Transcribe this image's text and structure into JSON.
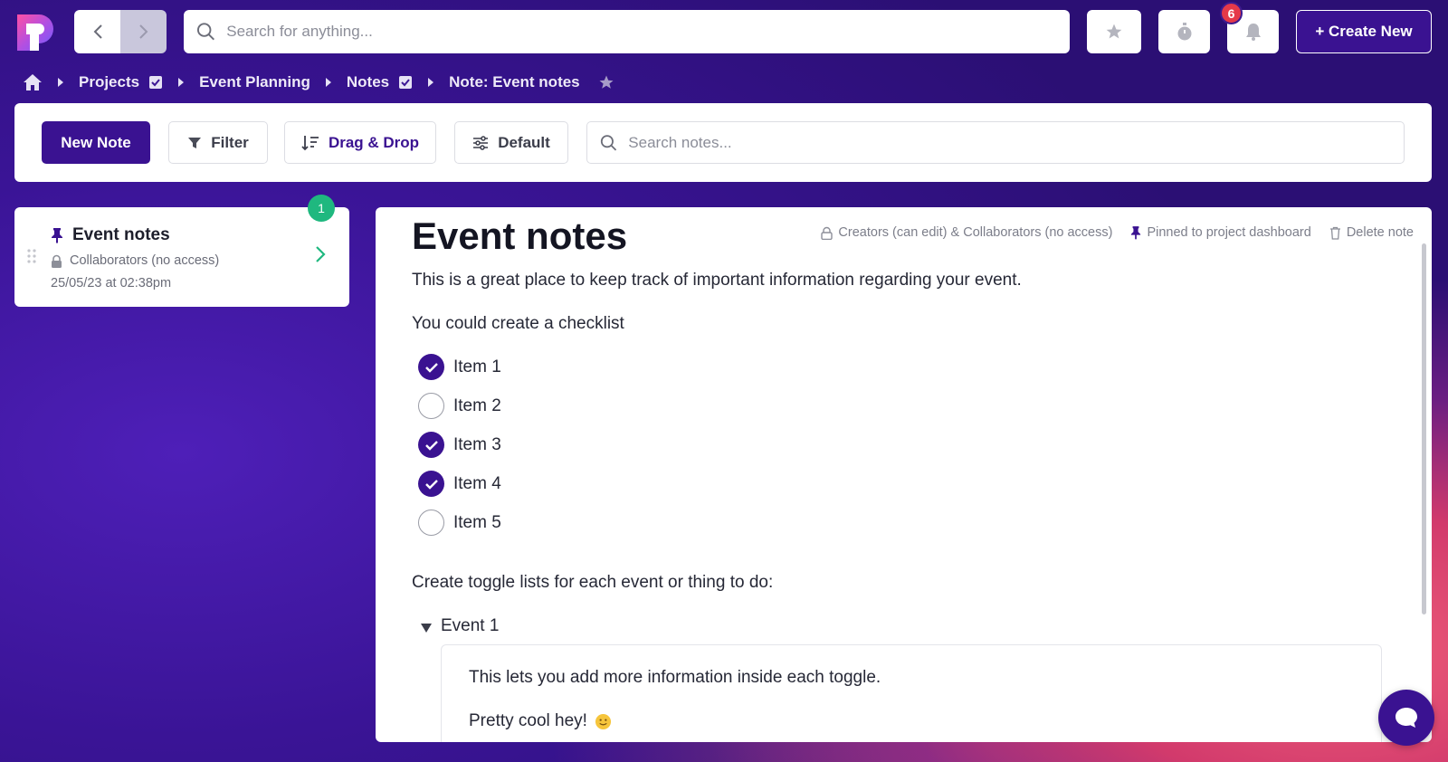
{
  "topbar": {
    "search_placeholder": "Search for anything...",
    "notification_count": "6",
    "create_label": "+ Create New"
  },
  "breadcrumb": {
    "items": [
      "Projects",
      "Event Planning",
      "Notes",
      "Note: Event notes"
    ]
  },
  "toolbar": {
    "new_note_label": "New Note",
    "filter_label": "Filter",
    "drag_label": "Drag & Drop",
    "default_label": "Default",
    "search_placeholder": "Search notes..."
  },
  "note_list": {
    "count": "1",
    "items": [
      {
        "title": "Event notes",
        "access": "Collaborators (no access)",
        "date": "25/05/23 at 02:38pm"
      }
    ]
  },
  "note": {
    "title": "Event notes",
    "meta": {
      "permissions": "Creators (can edit) & Collaborators (no access)",
      "pinned": "Pinned to project dashboard",
      "delete": "Delete note"
    },
    "intro": "This is a great place to keep track of important information regarding your event.",
    "checklist_heading": "You could create a checklist",
    "checklist": [
      {
        "label": "Item 1",
        "checked": true
      },
      {
        "label": "Item 2",
        "checked": false
      },
      {
        "label": "Item 3",
        "checked": true
      },
      {
        "label": "Item 4",
        "checked": true
      },
      {
        "label": "Item 5",
        "checked": false
      }
    ],
    "toggle_heading": "Create toggle lists for each event or thing to do:",
    "toggle": {
      "label": "Event 1",
      "lines": [
        "This lets you add more information inside each toggle.",
        "Pretty cool hey!"
      ]
    }
  },
  "colors": {
    "brand": "#3a1291",
    "badge_red": "#e53949",
    "badge_green": "#1fb87f"
  }
}
